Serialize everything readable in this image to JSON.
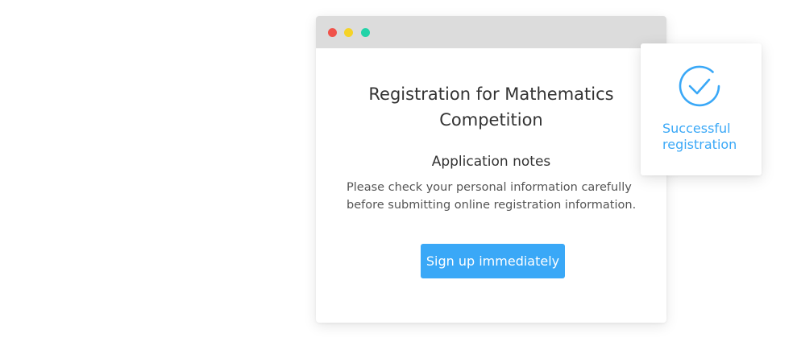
{
  "colors": {
    "accent": "#3aa8f7",
    "dot_red": "#f0524a",
    "dot_yellow": "#f5d327",
    "dot_green": "#22d3a8",
    "titlebar": "#dcdcdc"
  },
  "window": {
    "title": "Registration for Mathematics Competition",
    "notes_heading": "Application notes",
    "notes_body": "Please check your personal information carefully before submitting online registration information.",
    "signup_label": "Sign up immediately"
  },
  "success": {
    "icon": "check-circle-icon",
    "label": "Successful registration"
  }
}
